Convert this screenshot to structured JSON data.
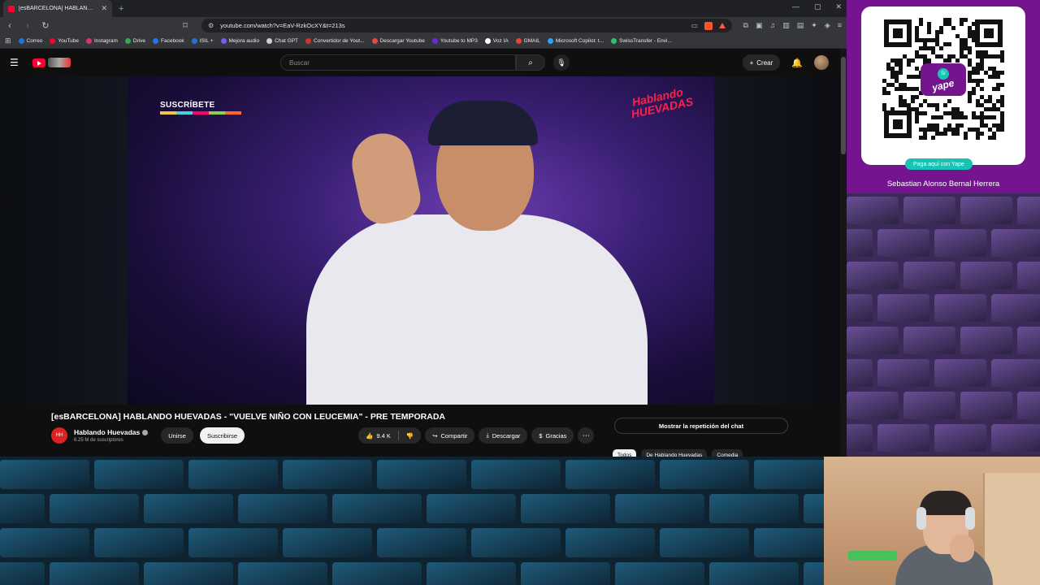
{
  "browser": {
    "tab_title": "[esBARCELONA] HABLANDO HUEVADAS",
    "url": "youtube.com/watch?v=EaV-RzkOcXY&t=213s",
    "bookmarks": [
      {
        "label": "Correo",
        "color": "#1a73e8"
      },
      {
        "label": "YouTube",
        "color": "#ff0033"
      },
      {
        "label": "Instagram",
        "color": "#e1306c"
      },
      {
        "label": "Drive",
        "color": "#34a853"
      },
      {
        "label": "Facebook",
        "color": "#1877f2"
      },
      {
        "label": "ISIL +",
        "color": "#2b6fd6"
      },
      {
        "label": "Mejora audio",
        "color": "#7a5af8"
      },
      {
        "label": "Chat GPT",
        "color": "#cfcfcf"
      },
      {
        "label": "Convertidor de Yout...",
        "color": "#d93025"
      },
      {
        "label": "Descargar Youtube",
        "color": "#ef4444"
      },
      {
        "label": "Youtube to MP3",
        "color": "#6d28d9"
      },
      {
        "label": "Voz IA",
        "color": "#ffffff"
      },
      {
        "label": "GMAIL",
        "color": "#ea4335"
      },
      {
        "label": "Microsoft Copilot: t...",
        "color": "#2aa3ff"
      },
      {
        "label": "SwissTransfer - Envi...",
        "color": "#35c16b"
      }
    ]
  },
  "youtube": {
    "search_placeholder": "Buscar",
    "create_label": "Crear",
    "video_badge": "SUSCRÍBETE",
    "video_logo_text": "Hablando HUEVADAS",
    "video_title": "[esBARCELONA] HABLANDO HUEVADAS - \"VUELVE NIÑO CON LEUCEMIA\" - PRE TEMPORADA",
    "channel_name": "Hablando Huevadas",
    "channel_subs": "6.25 M de suscriptores",
    "join_label": "Unirse",
    "subscribe_label": "Suscribirse",
    "likes": "9.4 K",
    "share_label": "Compartir",
    "download_label": "Descargar",
    "thanks_label": "Gracias",
    "chat_replay_label": "Mostrar la repetición del chat",
    "chips": [
      "Todos",
      "De Hablando Huevadas",
      "Comedia"
    ]
  },
  "overlay": {
    "pay_label": "Paga aquí con Yape",
    "payee_name": "Sebastian Alonso Bernal Herrera",
    "yape_word": "yape",
    "yape_symbol": "S/",
    "brand_color": "#74158f",
    "accent_color": "#17c3b2"
  }
}
